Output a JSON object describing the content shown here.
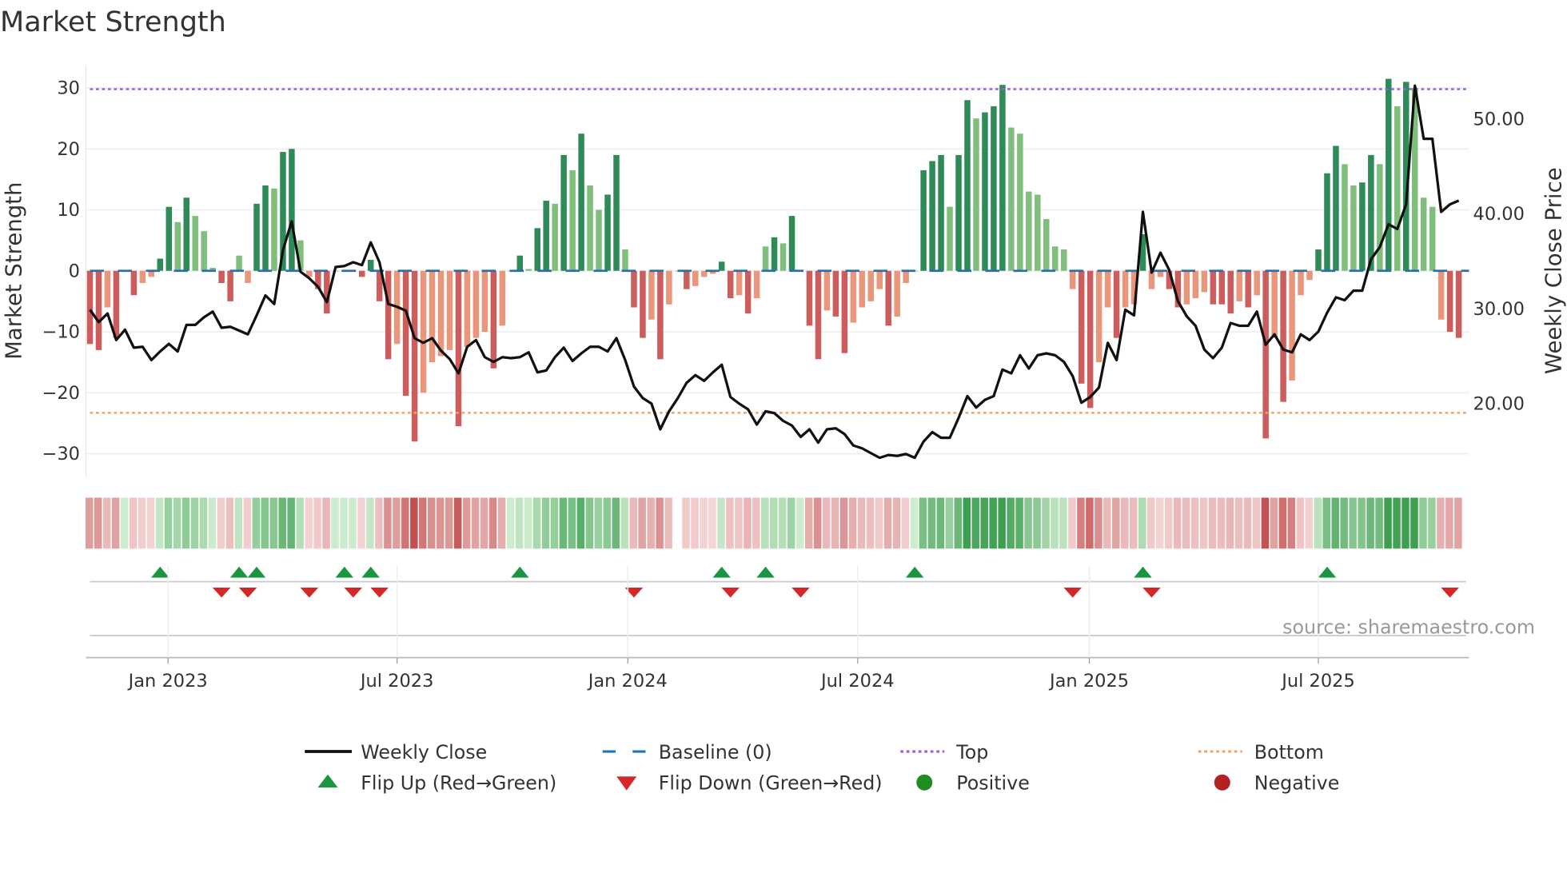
{
  "chart_data": {
    "type": "bar",
    "title": "Market Strength",
    "ylabel": "Market Strength",
    "y2label": "Weekly Close Price",
    "ylim": [
      -35,
      33
    ],
    "y2lim": [
      12,
      56
    ],
    "yticks": [
      30,
      20,
      10,
      0,
      -10,
      -20,
      -30
    ],
    "yticklabels": [
      "30",
      "20",
      "10",
      "0",
      "−10",
      "−20",
      "−30"
    ],
    "y2ticks": [
      50,
      40,
      30,
      20
    ],
    "y2ticklabels": [
      "50.00",
      "40.00",
      "30.00",
      "20.00"
    ],
    "xticks": [
      {
        "label": "Jan 2023",
        "week_index": 8.9
      },
      {
        "label": "Jul 2023",
        "week_index": 35
      },
      {
        "label": "Jan 2024",
        "week_index": 61.3
      },
      {
        "label": "Jul 2024",
        "week_index": 87.5
      },
      {
        "label": "Jan 2025",
        "week_index": 113.9
      },
      {
        "label": "Jul 2025",
        "week_index": 140
      }
    ],
    "top_level": 29.8,
    "bottom_level": -23.3,
    "baseline": 0,
    "grid": true,
    "strength": [
      -12,
      -13,
      -6,
      -11,
      0,
      -4,
      -2,
      -1,
      2,
      10.5,
      8,
      12,
      9,
      6.5,
      0.5,
      -2,
      -5,
      2.5,
      -2,
      11,
      14,
      13.5,
      19.5,
      20,
      5,
      -1,
      -3,
      -7,
      0,
      0,
      0,
      -1,
      1.8,
      -5,
      -14.5,
      -12,
      -20.5,
      -28,
      -20,
      -15,
      -14,
      -13,
      -25.5,
      -12.5,
      -11,
      -10,
      -16,
      -9,
      0,
      2.5,
      0.3,
      7,
      11.5,
      11,
      19,
      16.5,
      22.5,
      14,
      10,
      12.5,
      19,
      3.5,
      -6,
      -11,
      -8,
      -14.5,
      -5.5,
      0,
      -3,
      -2.5,
      -1,
      -0.5,
      1.5,
      -4.5,
      -4,
      -7,
      -4.5,
      4,
      5.5,
      4.5,
      9,
      0,
      -9,
      -14.5,
      -6.5,
      -7.5,
      -13.5,
      -8.5,
      -6,
      -5,
      -3,
      -9,
      -7.5,
      -2,
      0,
      16.5,
      18,
      19,
      10.5,
      19,
      28,
      25,
      26,
      27,
      30.5,
      23.5,
      22.5,
      13,
      12.5,
      8.5,
      4,
      3.5,
      -3,
      -18.5,
      -22.5,
      -15,
      -6,
      -11,
      -6,
      -5.5,
      6,
      -3,
      -1,
      -3,
      -6,
      -5.5,
      -4.5,
      -3.5,
      -5.5,
      -5.5,
      -7,
      -5,
      -6,
      -4,
      -27.5,
      -11,
      -21.5,
      -18,
      -4,
      -1.5,
      3.5,
      16,
      20.5,
      17.5,
      14,
      14.5,
      19,
      17.5,
      31.5,
      27,
      31,
      30,
      12,
      10.5,
      -8,
      -10,
      -11
    ],
    "weekly_close": [
      29.8,
      28.5,
      29.4,
      26.6,
      27.7,
      25.8,
      25.9,
      24.5,
      25.4,
      26.2,
      25.4,
      28.2,
      28.2,
      29,
      29.6,
      27.9,
      28,
      27.6,
      27.2,
      29.2,
      31.3,
      30.4,
      36.1,
      39.1,
      33.8,
      33.1,
      32.2,
      30.6,
      34.3,
      34.4,
      34.8,
      34.5,
      36.9,
      34.8,
      30.4,
      30.1,
      29.7,
      26.8,
      26.3,
      26.8,
      25.5,
      24.6,
      23.1,
      25.9,
      26.6,
      24.8,
      24.3,
      24.8,
      24.7,
      24.8,
      25.3,
      23.2,
      23.4,
      24.8,
      25.8,
      24.4,
      25.2,
      25.9,
      25.9,
      25.4,
      26.8,
      24.5,
      21.7,
      20.5,
      19.9,
      17.2,
      19.1,
      20.5,
      22.1,
      22.9,
      22.3,
      23.2,
      24,
      20.6,
      19.9,
      19.3,
      17.7,
      19.1,
      18.9,
      18.1,
      17.6,
      16.4,
      17.2,
      15.8,
      17.2,
      17.3,
      16.7,
      15.5,
      15.2,
      14.7,
      14.2,
      14.5,
      14.4,
      14.6,
      14.2,
      15.9,
      16.9,
      16.3,
      16.3,
      18.4,
      20.7,
      19.5,
      20.3,
      20.7,
      23.5,
      23.1,
      25,
      23.6,
      25,
      25.2,
      25,
      24.3,
      22.8,
      20,
      20.6,
      21.6,
      26.3,
      24.5,
      29.8,
      29.2,
      40.1,
      33.7,
      35.8,
      34,
      30.7,
      29.1,
      28.1,
      25.6,
      24.7,
      25.8,
      28.4,
      28.1,
      28.1,
      29.6,
      26.1,
      27.2,
      25.6,
      25.3,
      27.2,
      26.6,
      27.5,
      29.5,
      31.1,
      30.8,
      31.8,
      31.8,
      35.1,
      36.4,
      38.8,
      38.3,
      40.9,
      53.4,
      47.8,
      47.8,
      40.1,
      40.9,
      41.3
    ],
    "flip_up_indices": [
      8,
      17,
      19,
      29,
      32,
      49,
      72,
      77,
      94,
      120,
      141
    ],
    "flip_down_indices": [
      15,
      18,
      25,
      30,
      33,
      62,
      73,
      81,
      112,
      121,
      155
    ],
    "legend": {
      "placement": "bottom",
      "items": [
        {
          "label": "Weekly Close",
          "symbol": "line",
          "color": "#111111"
        },
        {
          "label": "Baseline (0)",
          "symbol": "dash",
          "color": "#1f77b4"
        },
        {
          "label": "Top",
          "symbol": "dot",
          "color": "#9b5de5"
        },
        {
          "label": "Bottom",
          "symbol": "dot",
          "color": "#f4a261"
        },
        {
          "label": "Flip Up (Red→Green)",
          "symbol": "triangle-up",
          "color": "#1a9641"
        },
        {
          "label": "Flip Down (Green→Red)",
          "symbol": "triangle-down",
          "color": "#d62728"
        },
        {
          "label": "Positive",
          "symbol": "circle",
          "color": "#228b22"
        },
        {
          "label": "Negative",
          "symbol": "circle",
          "color": "#b22222"
        }
      ]
    },
    "colors": {
      "pos_strong": "#2e8b57",
      "pos_weak": "#7fbf7b",
      "neg_strong": "#cd5c5c",
      "neg_weak": "#e9967a"
    },
    "source": "source: sharemaestro.com"
  }
}
